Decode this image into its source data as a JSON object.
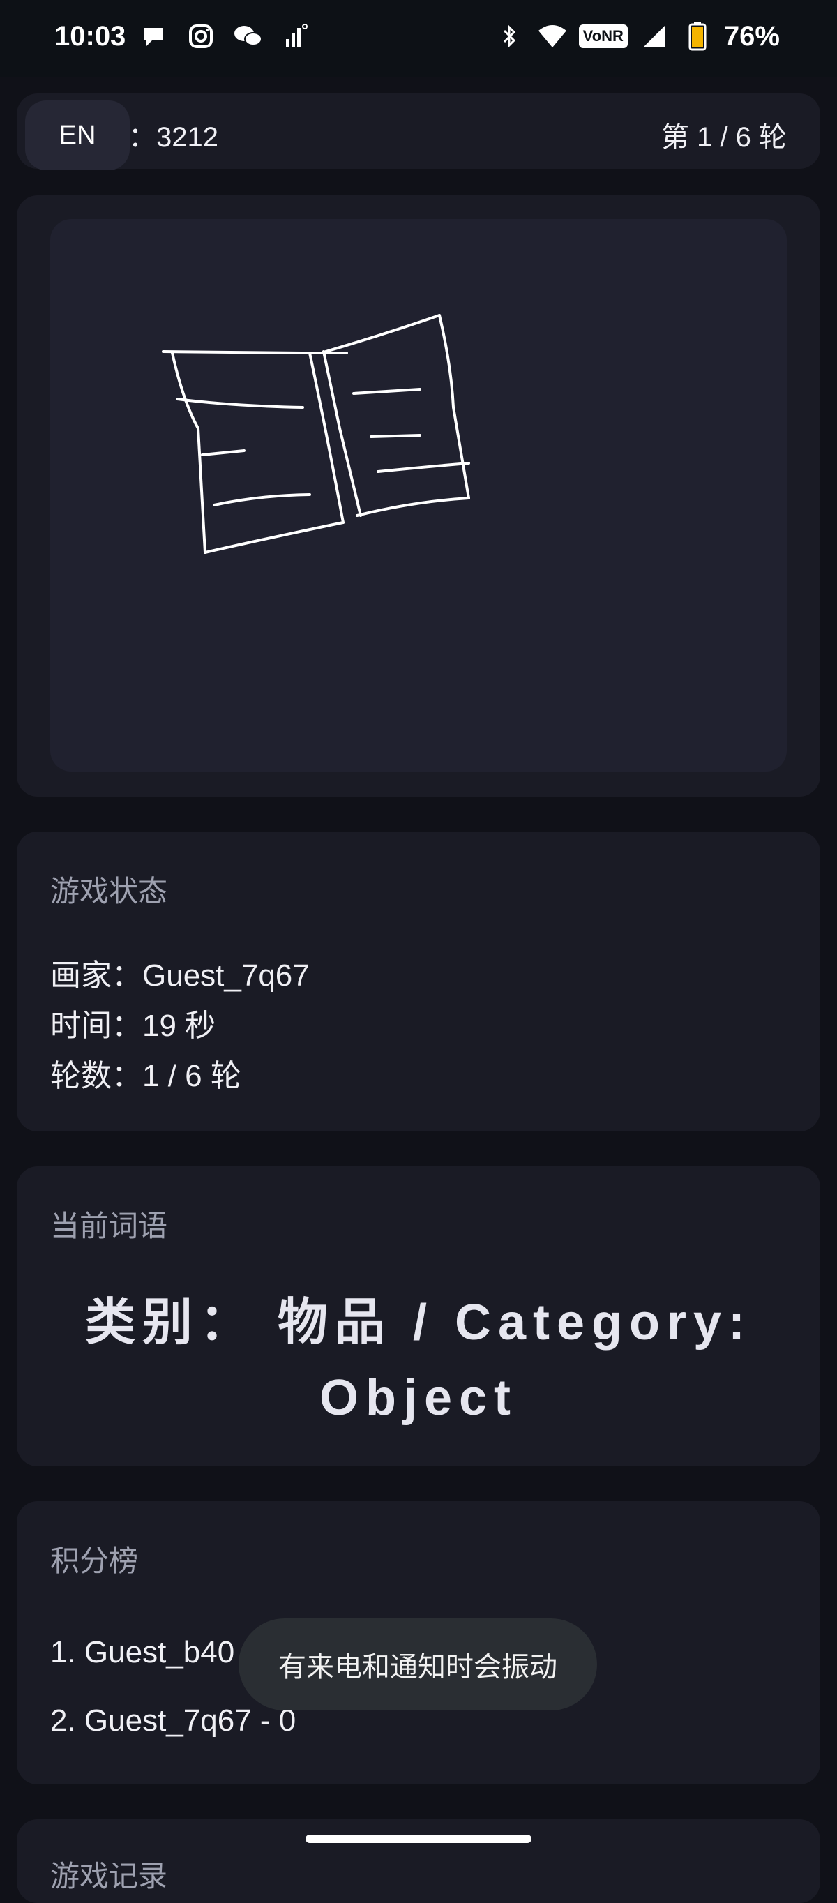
{
  "status_bar": {
    "time": "10:03",
    "left_icons": [
      "chat-bubble-icon",
      "instagram-icon",
      "wechat-icon",
      "signal-bars-icon"
    ],
    "right_icons": [
      "bluetooth-icon",
      "wifi-icon",
      "vonr-icon",
      "cell-signal-icon",
      "battery-icon"
    ],
    "vonr_label": "VoNR",
    "battery_text": "76%"
  },
  "header": {
    "language_button": "EN",
    "room_code": "：3212",
    "round_text": "第 1 / 6 轮"
  },
  "game_status": {
    "title": "游戏状态",
    "painter": "画家：Guest_7q67",
    "time": "时间：19 秒",
    "rounds": "轮数：1 / 6 轮"
  },
  "current_word": {
    "title": "当前词语",
    "text": "类别： 物品 / Category: Object"
  },
  "leaderboard": {
    "title": "积分榜",
    "entries": [
      "1. Guest_b40",
      "2. Guest_7q67 - 0"
    ]
  },
  "next_section": {
    "title": "游戏记录"
  },
  "toast": {
    "text": "有来电和通知时会振动"
  },
  "colors": {
    "background": "#101118",
    "card": "#1a1b25",
    "canvas": "#20212f",
    "muted_text": "#9ea1b0",
    "toast": "#2a2e33"
  }
}
